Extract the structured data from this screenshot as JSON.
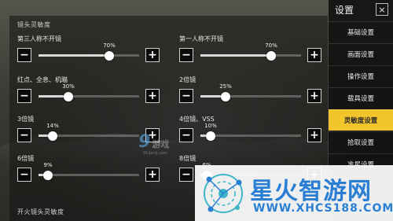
{
  "panel": {
    "section_title": "镜头灵敏度",
    "footer_title": "开火镜头灵敏度",
    "sliders": [
      {
        "label": "第三人称不开镜",
        "value": 70,
        "value_text": "70%"
      },
      {
        "label": "第一人称不开镜",
        "value": 70,
        "value_text": "70%"
      },
      {
        "label": "红点、全息、机瞄",
        "value": 30,
        "value_text": "30%"
      },
      {
        "label": "2倍镜",
        "value": 25,
        "value_text": "25%"
      },
      {
        "label": "3倍镜",
        "value": 14,
        "value_text": "14%"
      },
      {
        "label": "4倍镜、VSS",
        "value": 10,
        "value_text": "10%"
      },
      {
        "label": "6倍镜",
        "value": 9,
        "value_text": "9%"
      },
      {
        "label": "8倍镜",
        "value": 6,
        "value_text": "6%"
      }
    ],
    "minus_symbol": "−",
    "plus_symbol": "+"
  },
  "sidebar": {
    "title": "设置",
    "close_symbol": "×",
    "active_index": 5,
    "items": [
      "基础设置",
      "画面设置",
      "操作设置",
      "载具设置",
      "灵敏度设置",
      "拾取设置",
      "准星设置"
    ]
  },
  "watermarks": {
    "logo_text": "9",
    "logo_suffix": "游戏",
    "logo_sub": "91danji.com",
    "brand_name": "星火智游网",
    "brand_url": "WWW.XHCS188.COM"
  },
  "colors": {
    "accent": "#f2c52d",
    "brand_blue": "#2a7fd4"
  }
}
